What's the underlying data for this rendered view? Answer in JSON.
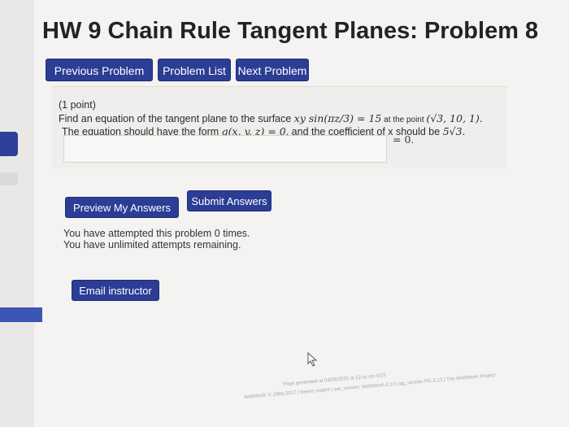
{
  "title": "HW 9 Chain Rule Tangent Planes: Problem 8",
  "nav": {
    "previous_label": "Previous Problem",
    "list_label": "Problem List",
    "next_label": "Next Problem"
  },
  "problem": {
    "points": "(1 point)",
    "prompt_start": "Find an equation of the tangent plane to the surface ",
    "surface_eq": "xy sin(πz/3) = 15",
    "prompt_point_text": " at the point ",
    "point": "(√3, 10, 1).",
    "form_start": "The equation should have the form ",
    "form_eq": "g(x, y, z) = 0",
    "form_end": ", and the coefficient of x should be ",
    "coefficient": "5√3.",
    "answer_value": "",
    "answer_suffix": "= 0."
  },
  "actions": {
    "preview_label": "Preview My Answers",
    "submit_label": "Submit Answers"
  },
  "attempts": {
    "line1": "You have attempted this problem 0 times.",
    "line2": "You have unlimited attempts remaining."
  },
  "email_label": "Email instructor",
  "footer": {
    "line1": "Page generated at 04/08/2020 at 12:xx am EDT",
    "line2": "WeBWorK © 1996-2017 | theme: math4 | ww_version: WeBWorK-2.13 | pg_version PG-2.13 | The WeBWorK Project"
  },
  "colors": {
    "button_blue": "#2b3d94",
    "background": "#f4f3f1"
  }
}
